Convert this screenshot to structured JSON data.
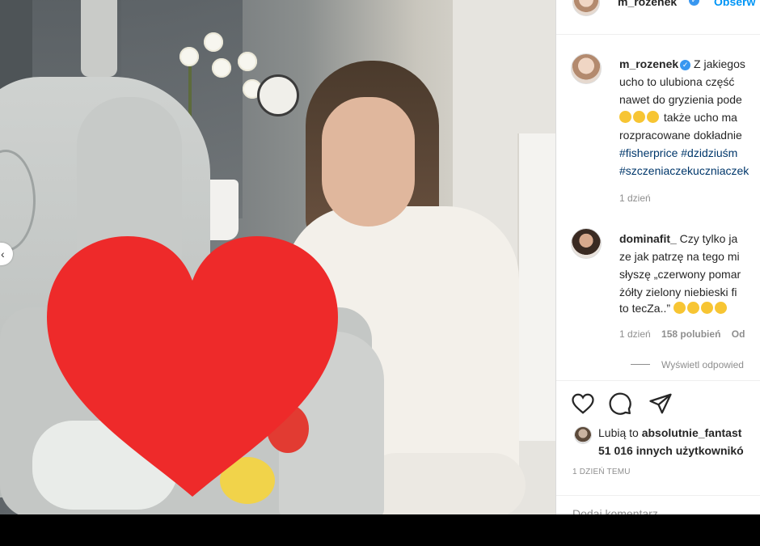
{
  "header": {
    "username": "m_rozenek",
    "follow_label": "Obserw"
  },
  "caption": {
    "username": "m_rozenek",
    "line1": "Z jakiegos",
    "line2": "ucho to ulubiona część",
    "line3": "nawet do gryzienia pode",
    "line4": "także ucho ma",
    "line5": "rozpracowane dokładnie",
    "hashtags1": "#fisherprice #dzidziuśm",
    "hashtags2": "#szczeniaczekuczniaczek",
    "time": "1 dzień"
  },
  "comment": {
    "username": "dominafit_",
    "line1": "Czy tylko ja",
    "line2": "ze jak patrzę na tego mi",
    "line3": "słyszę „czerwony pomar",
    "line4": "żółty zielony niebieski fi",
    "line5": "to tecZa..”",
    "time": "1 dzień",
    "likes": "158 polubień",
    "reply": "Od",
    "view_replies": "Wyświetl odpowied"
  },
  "likes": {
    "prefix": "Lubią to ",
    "user": "absolutnie_fantast",
    "others": "51 016 innych użytkownikó"
  },
  "timestamp": "1 DZIEŃ TEMU",
  "add_comment_placeholder": "Dodaj komentarz...",
  "icons": [
    "heart-icon",
    "comment-icon",
    "share-icon",
    "chevron-left-icon",
    "verified-badge-icon"
  ],
  "colors": {
    "accent": "#3897f0",
    "hashtag": "#00376b",
    "heart_overlay": "#ee2a2a",
    "muted": "#8e8e8e"
  }
}
